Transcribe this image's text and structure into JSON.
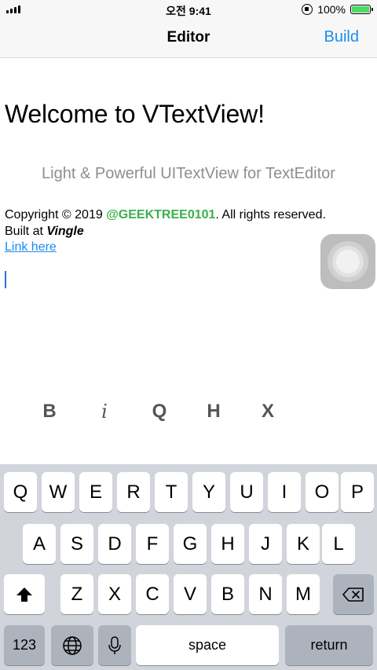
{
  "status_bar": {
    "time": "오전 9:41",
    "battery": "100%",
    "battery_color": "#4cd964"
  },
  "nav": {
    "title": "Editor",
    "build_label": "Build",
    "accent": "#1a8cf0"
  },
  "editor": {
    "heading": "Welcome to VTextView!",
    "subtitle": "Light & Powerful UITextView for TextEditor",
    "copyright_prefix": "Copyright © 2019 ",
    "copyright_handle": "@GEEKTREE0101",
    "copyright_suffix": ". All rights reserved.",
    "built_prefix": "Built at ",
    "built_name": "Vingle",
    "link_text": "Link here",
    "handle_color": "#3ab04a"
  },
  "format_toolbar": {
    "bold": "B",
    "italic": "i",
    "quote": "Q",
    "header": "H",
    "clear": "X"
  },
  "keyboard": {
    "row1": [
      "Q",
      "W",
      "E",
      "R",
      "T",
      "Y",
      "U",
      "I",
      "O",
      "P"
    ],
    "row2": [
      "A",
      "S",
      "D",
      "F",
      "G",
      "H",
      "J",
      "K",
      "L"
    ],
    "row3": [
      "Z",
      "X",
      "C",
      "V",
      "B",
      "N",
      "M"
    ],
    "numbers_label": "123",
    "space_label": "space",
    "return_label": "return"
  },
  "icons": {
    "shift": "shift-icon",
    "backspace": "backspace-icon",
    "globe": "globe-icon",
    "mic": "microphone-icon",
    "assistive": "assistive-touch-icon"
  }
}
